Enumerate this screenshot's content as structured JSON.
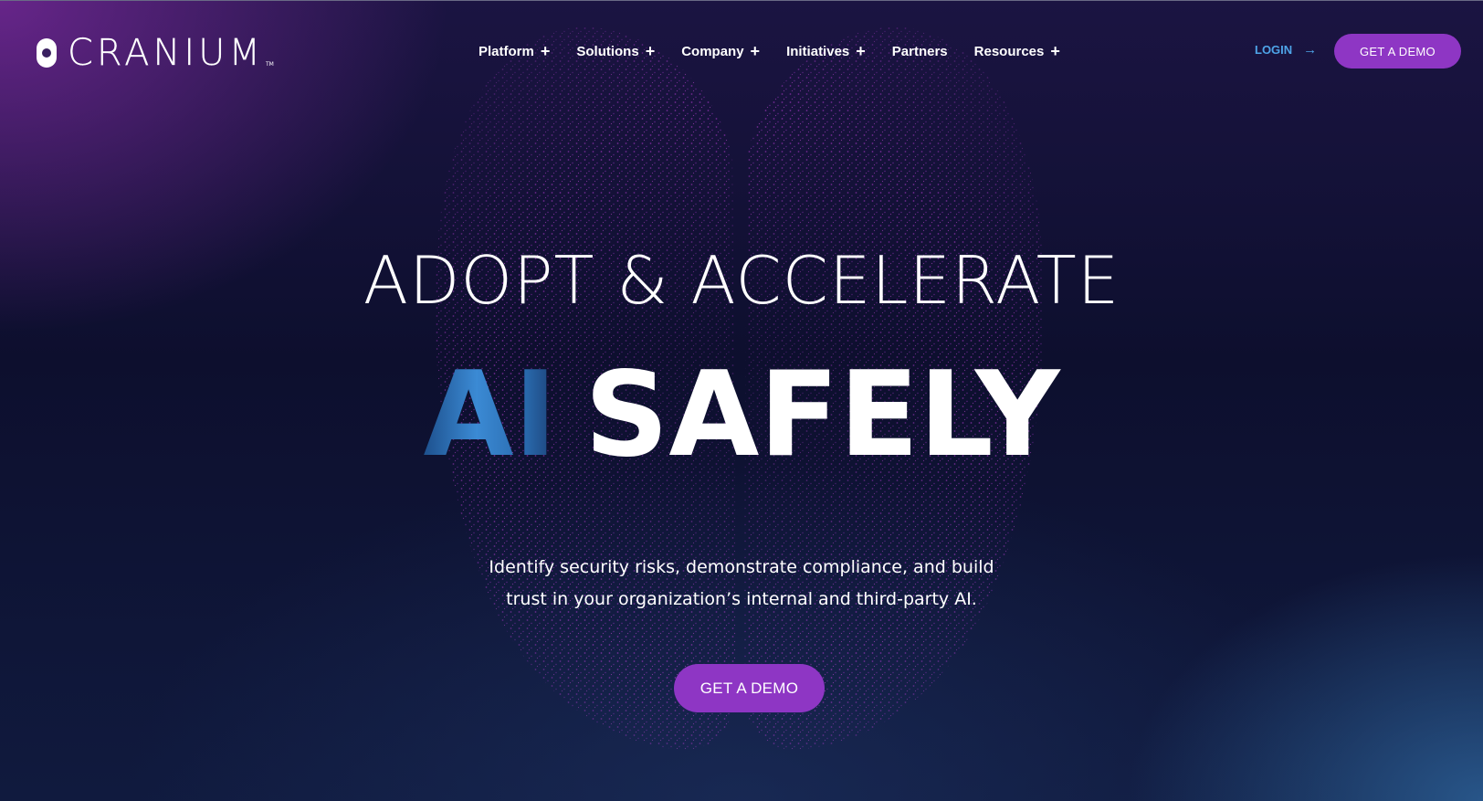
{
  "brand": {
    "name": "CRANIUM",
    "trademark": "TM"
  },
  "nav": {
    "items": [
      {
        "label": "Platform",
        "icon": "plus-icon",
        "expand": "+"
      },
      {
        "label": "Solutions",
        "icon": "plus-icon",
        "expand": "+"
      },
      {
        "label": "Company",
        "icon": "plus-icon",
        "expand": "+"
      },
      {
        "label": "Initiatives",
        "icon": "plus-icon",
        "expand": "+"
      },
      {
        "label": "Partners"
      },
      {
        "label": "Resources",
        "icon": "plus-icon",
        "expand": "+"
      }
    ]
  },
  "header": {
    "login_label": "LOGIN",
    "login_icon": "arrow-right-icon",
    "login_arrow": "→",
    "cta_label": "GET A DEMO"
  },
  "hero": {
    "line1": "ADOPT & ACCELERATE",
    "line2_highlight": "AI",
    "line2_rest": "SAFELY",
    "subtitle_line1": "Identify security risks, demonstrate compliance, and build",
    "subtitle_line2": "trust in your organization’s internal and third-party AI.",
    "cta_label": "GET A DEMO",
    "background_image": "particle-brain-graphic"
  },
  "colors": {
    "accent_purple": "#8e36c4",
    "login_blue": "#4ea4e8",
    "ai_gradient_blue": "#3b8ad4",
    "background_navy": "#0d0f2e",
    "brain_dots": "#b43cd2"
  }
}
